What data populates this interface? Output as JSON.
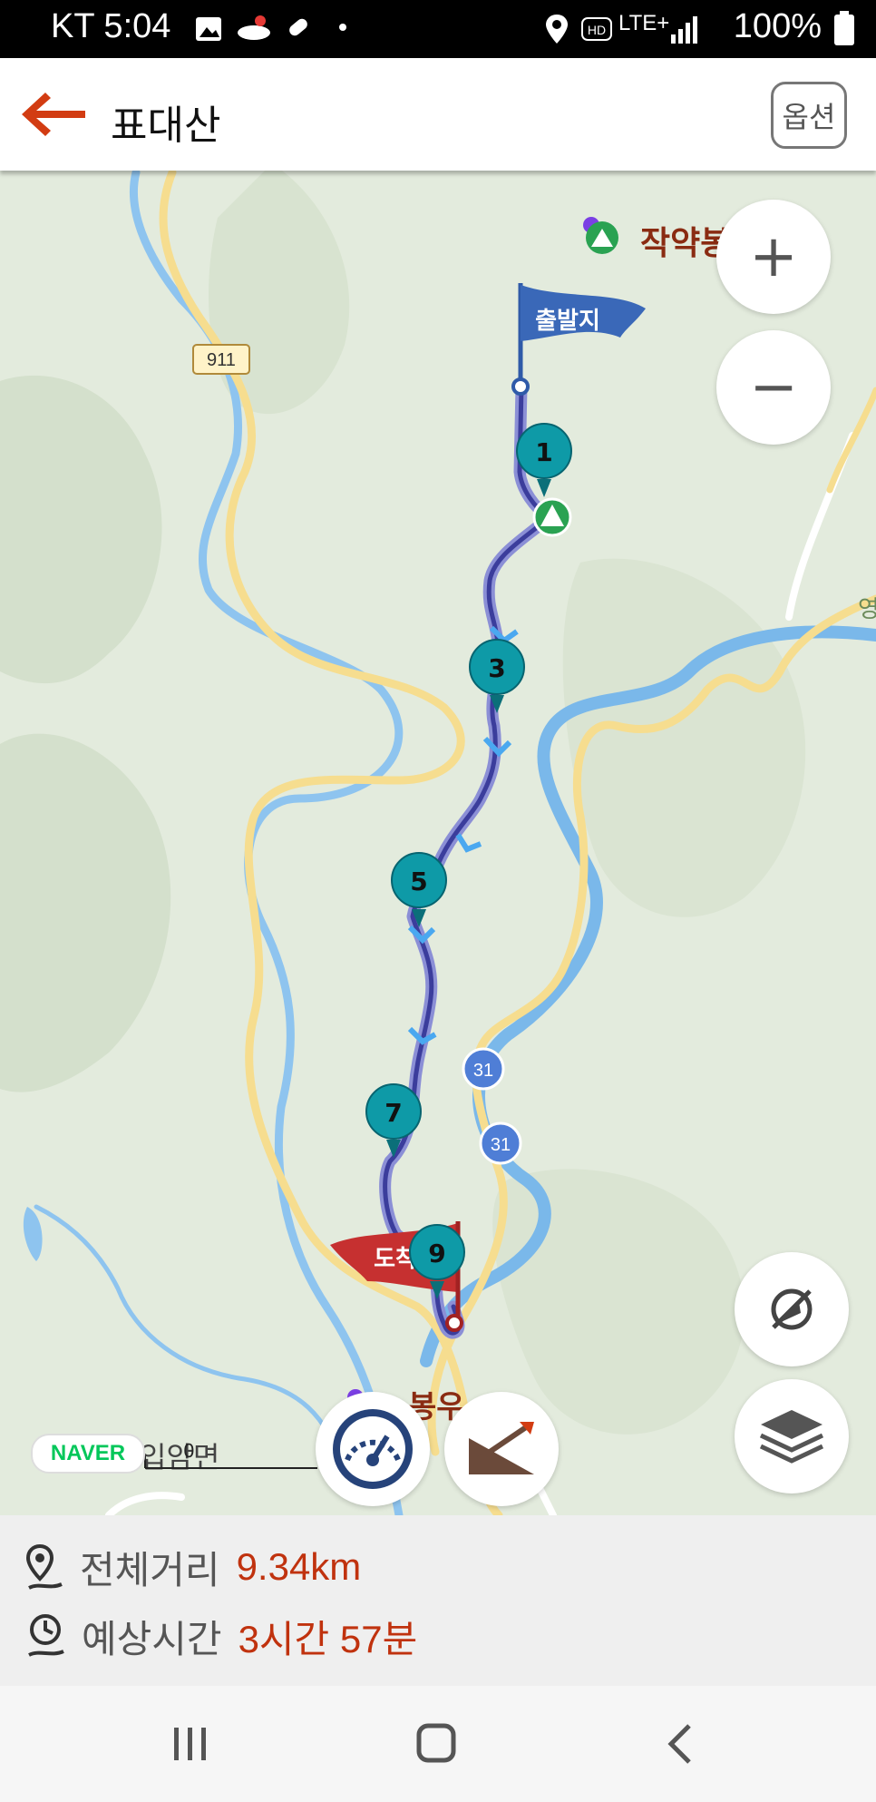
{
  "status_bar": {
    "carrier_time": "KT 5:04",
    "network": "LTE+",
    "battery": "100%",
    "icons": [
      "gallery-icon",
      "app-icon",
      "phone-icon",
      "dot-icon",
      "location-icon",
      "hd-icon",
      "signal-icon",
      "battery-icon"
    ]
  },
  "header": {
    "title": "표대산",
    "options_label": "옵션",
    "back_icon": "back-arrow-icon"
  },
  "map": {
    "start_flag_label": "출발지",
    "end_flag_label": "도착",
    "poi_label": "작약봉",
    "edge_label": "영",
    "town_label": "입암면",
    "bottom_label": "봉우",
    "road_911": "911",
    "road_31_a": "31",
    "road_31_b": "31",
    "waypoints": [
      "1",
      "3",
      "5",
      "7",
      "9"
    ],
    "scale_label": "0",
    "provider": "NAVER",
    "zoom_in": "+",
    "zoom_out": "−",
    "colors": {
      "route": "#3b3d9c",
      "waypoint": "#0e9aa7",
      "start_flag": "#3a68b8",
      "end_flag": "#c63030",
      "river": "#7ab8ea",
      "road": "#f6dd8f"
    }
  },
  "info": {
    "distance_label": "전체거리",
    "distance_value": "9.34km",
    "time_label": "예상시간",
    "time_value": "3시간 57분"
  }
}
